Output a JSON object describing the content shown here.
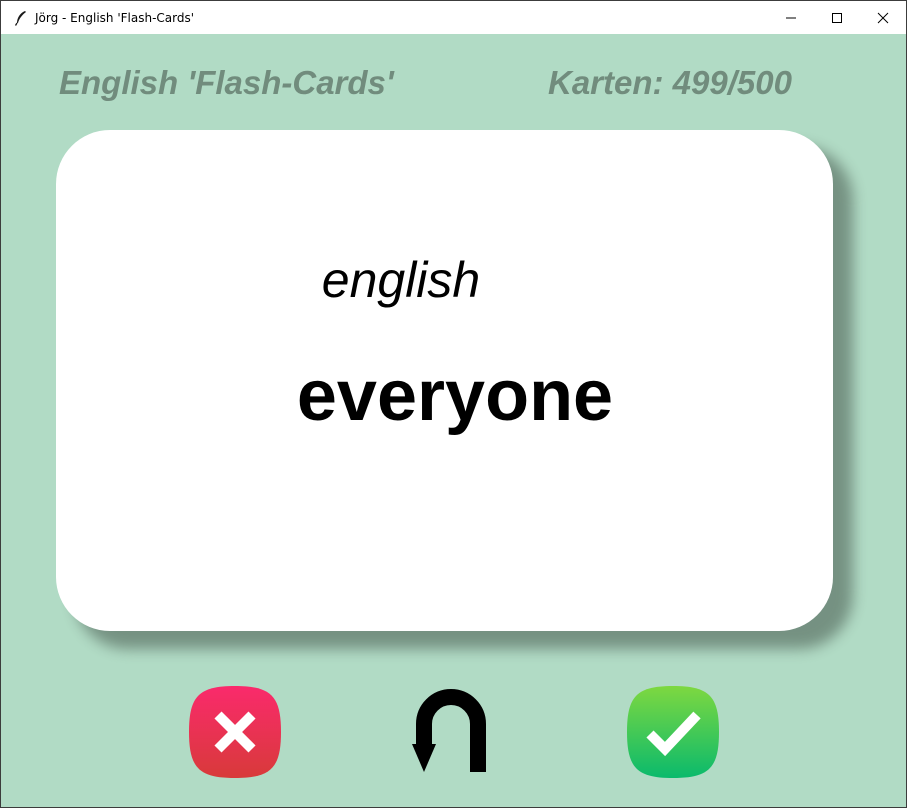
{
  "window": {
    "title": "Jörg - English 'Flash-Cards'",
    "controls": [
      "minimize",
      "maximize",
      "close"
    ]
  },
  "header": {
    "title": "English 'Flash-Cards'",
    "count": "Karten: 499/500"
  },
  "card": {
    "language": "english",
    "word": "everyone"
  },
  "buttons": {
    "wrong_icon": "x-icon",
    "flip_icon": "u-turn-arrow-icon",
    "right_icon": "checkmark-icon"
  },
  "colors": {
    "background": "#b1dbc5",
    "header_text": "#718c7d",
    "card": "#ffffff",
    "wrong_button": "#e8344f",
    "right_button": "#35c45a"
  }
}
